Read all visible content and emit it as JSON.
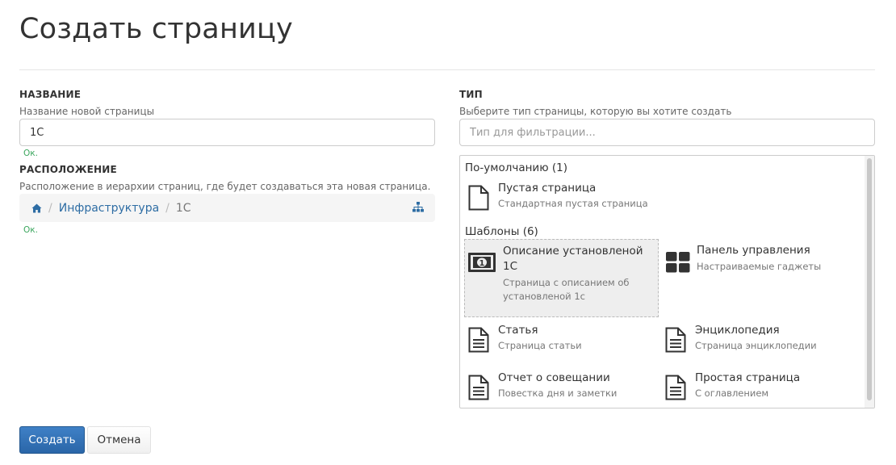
{
  "page": {
    "title": "Создать страницу"
  },
  "name_section": {
    "label": "НАЗВАНИЕ",
    "hint": "Название новой страницы",
    "value": "1С",
    "status": "Ок."
  },
  "location_section": {
    "label": "РАСПОЛОЖЕНИЕ",
    "hint": "Расположение в иерархии страниц, где будет создаваться эта новая страница.",
    "breadcrumb": {
      "parent": "Инфраструктура",
      "current": "1С",
      "separator": "/"
    },
    "status": "Ок."
  },
  "type_section": {
    "label": "ТИП",
    "hint": "Выберите тип страницы, которую вы хотите создать",
    "filter_placeholder": "Тип для фильтрации...",
    "groups": [
      {
        "title": "По-умолчанию (1)",
        "items": [
          {
            "name": "Пустая страница",
            "desc": "Стандартная пустая страница",
            "icon": "blank-page-icon"
          }
        ]
      },
      {
        "title": "Шаблоны (6)",
        "items": [
          {
            "name_line1": "Описание установленой",
            "name_line2": "1С",
            "desc_line1": "Страница с описанием об",
            "desc_line2": "установленой 1с",
            "icon": "banknote-icon",
            "selected": true
          },
          {
            "name": "Панель управления",
            "desc": "Настраиваемые гаджеты",
            "icon": "dashboard-icon"
          },
          {
            "name": "Статья",
            "desc": "Страница статьи",
            "icon": "document-icon"
          },
          {
            "name": "Энциклопедия",
            "desc": "Страница энциклопедии",
            "icon": "document-icon"
          },
          {
            "name": "Отчет о совещании",
            "desc": "Повестка дня и заметки",
            "icon": "document-icon"
          },
          {
            "name": "Простая страница",
            "desc": "С оглавлением",
            "icon": "document-icon"
          }
        ]
      }
    ]
  },
  "actions": {
    "create": "Создать",
    "cancel": "Отмена"
  },
  "colors": {
    "primary": "#337ab7",
    "ok": "#3aa65d",
    "link": "#2e6da4"
  }
}
